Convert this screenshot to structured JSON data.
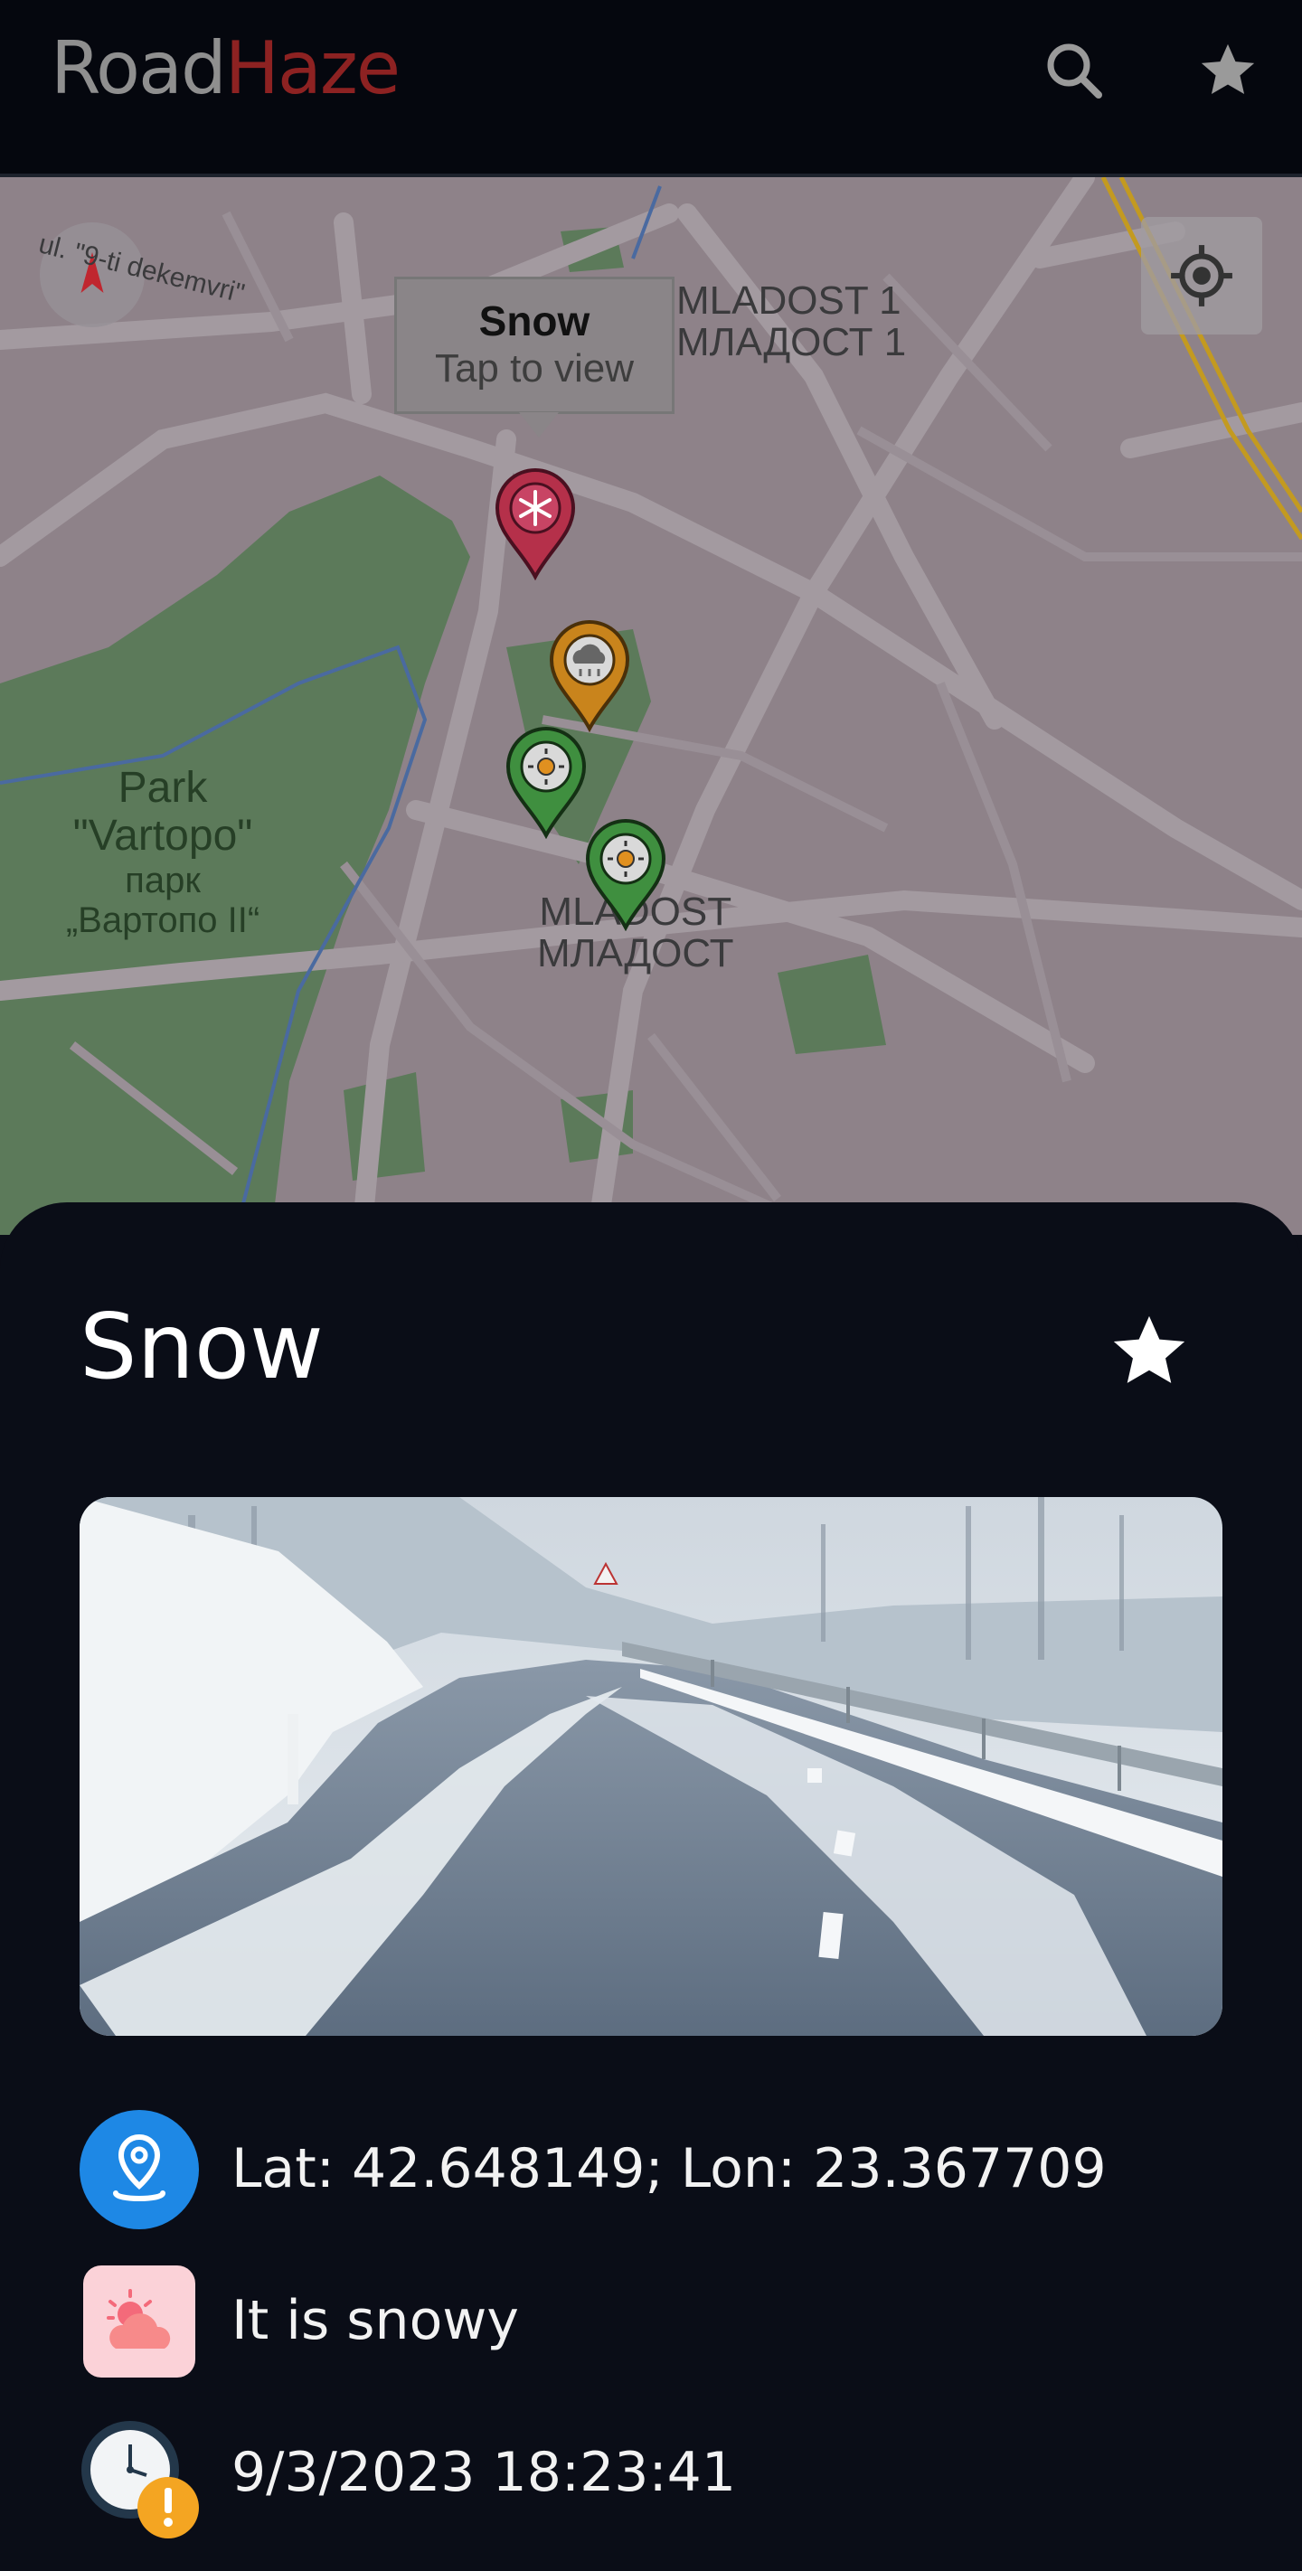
{
  "app": {
    "logo_part1": "Road",
    "logo_part2": "Haze",
    "search_icon": "search-icon",
    "favorites_icon": "star-icon"
  },
  "map": {
    "street_label": "ul. \"9-ti dekemvri\"",
    "district_top_latin": "MLADOST 1",
    "district_top_cyrillic": "МЛАДОСТ 1",
    "district_mid_latin": "MLADOST",
    "district_mid_cyrillic": "МЛАДОСТ",
    "park_line1": "Park",
    "park_line2": "\"Vartopo\"",
    "park_line3": "парк",
    "park_line4": "„Вартопо II“",
    "tooltip_title": "Snow",
    "tooltip_subtitle": "Tap to view",
    "markers": [
      {
        "type": "snow",
        "icon": "snowflake-icon",
        "color": "#b5304a"
      },
      {
        "type": "rain",
        "icon": "rain-cloud-icon",
        "color": "#c9841c"
      },
      {
        "type": "sunny",
        "icon": "sun-icon",
        "color": "#3f8f3f"
      },
      {
        "type": "sunny",
        "icon": "sun-icon",
        "color": "#3f8f3f"
      }
    ]
  },
  "detail": {
    "title": "Snow",
    "coordinates": "Lat: 42.648149; Lon: 23.367709",
    "condition": "It is snowy",
    "timestamp": "9/3/2023 18:23:41"
  },
  "colors": {
    "background": "#0a0d17",
    "accent_location": "#1e88e5",
    "logo_red": "#8d2222"
  }
}
